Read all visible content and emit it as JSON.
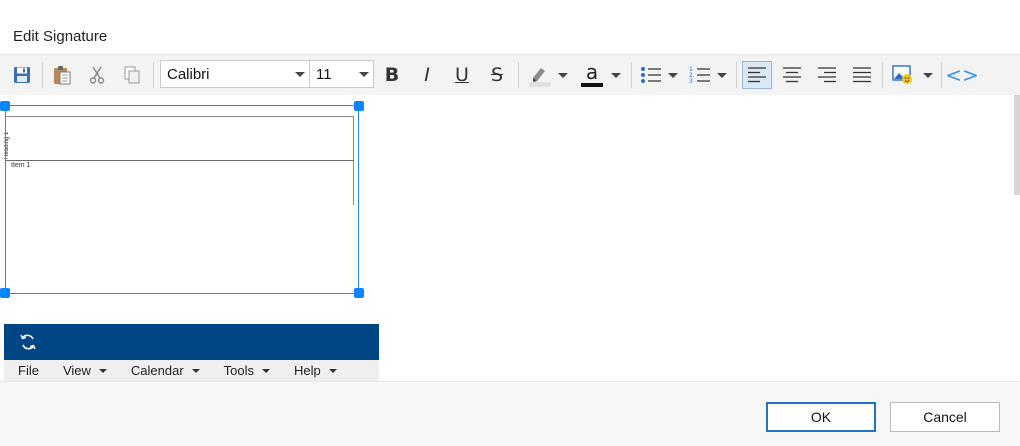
{
  "dialog": {
    "title": "Edit Signature"
  },
  "toolbar": {
    "font_name": "Calibri",
    "font_size": "11",
    "bold_label": "B",
    "italic_label": "I",
    "underline_label": "U",
    "strike_label": "S",
    "font_color_label": "a",
    "source_label": "<>",
    "icons": [
      "save-icon",
      "paste-icon",
      "cut-icon",
      "copy-icon",
      "highlight-icon",
      "font-color-icon",
      "bullet-list-icon",
      "numbered-list-icon",
      "align-left-icon",
      "align-center-icon",
      "align-right-icon",
      "justify-icon",
      "insert-image-icon",
      "html-source-icon"
    ]
  },
  "signature_image": {
    "heading": "Heading 1",
    "item": "Item 1"
  },
  "preview_menu": {
    "items": [
      {
        "label": "File",
        "has_dropdown": false
      },
      {
        "label": "View",
        "has_dropdown": true
      },
      {
        "label": "Calendar",
        "has_dropdown": true
      },
      {
        "label": "Tools",
        "has_dropdown": true
      },
      {
        "label": "Help",
        "has_dropdown": true
      }
    ]
  },
  "buttons": {
    "ok": "OK",
    "cancel": "Cancel"
  },
  "colors": {
    "accent": "#0a84ff",
    "appbar": "#004685",
    "ok_border": "#1f72c6"
  }
}
